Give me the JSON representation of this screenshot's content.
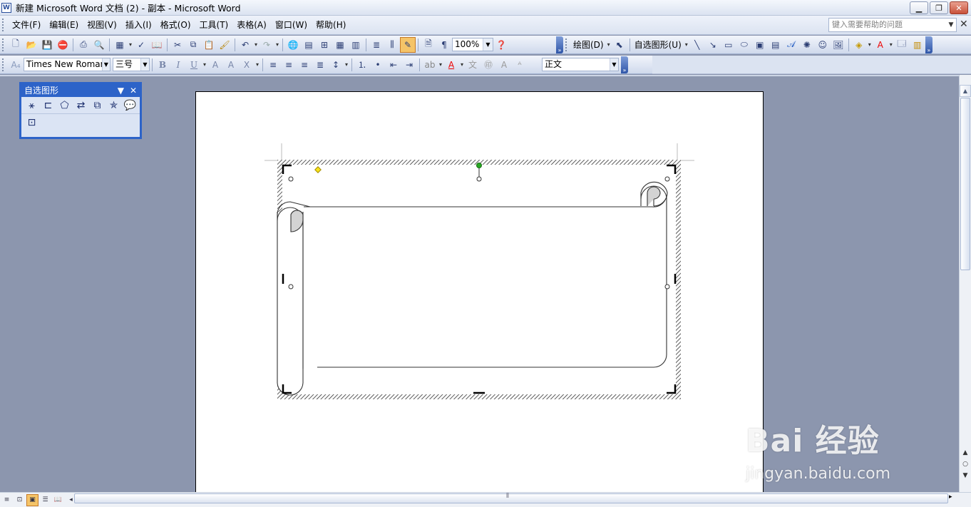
{
  "window": {
    "title": "新建 Microsoft Word 文档 (2) - 副本 - Microsoft Word",
    "app_icon_letter": "W",
    "buttons": [
      "minimize-icon",
      "restore-icon",
      "close-icon"
    ]
  },
  "menubar": {
    "items": [
      "文件(F)",
      "编辑(E)",
      "视图(V)",
      "插入(I)",
      "格式(O)",
      "工具(T)",
      "表格(A)",
      "窗口(W)",
      "帮助(H)"
    ],
    "help_placeholder": "键入需要帮助的问题"
  },
  "standard_toolbar": {
    "zoom": "100%",
    "draw_label": "绘图(D)",
    "autoshape_label": "自选图形(U)"
  },
  "format_toolbar": {
    "font_name": "Times New Roman",
    "font_size": "三号",
    "style": "正文"
  },
  "autoshapes_panel": {
    "title": "自选图形"
  },
  "document": {
    "shape": "horizontal-scroll-autoshape",
    "selected": true
  },
  "watermark": {
    "main": "Bai 经验",
    "sub": "jingyan.baidu.com"
  },
  "colors": {
    "workspace": "#8c96ae",
    "panel_title": "#2d63c8",
    "active_button": "#f5c468",
    "font_color_bar": "#ff0000",
    "highlight_bar": "#ffff00"
  }
}
